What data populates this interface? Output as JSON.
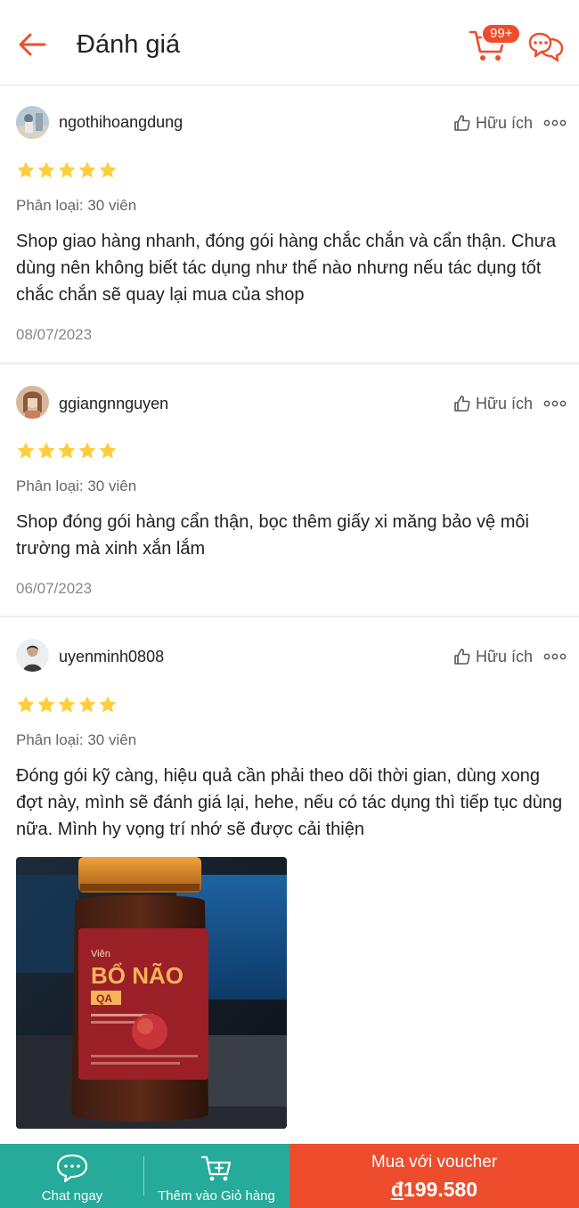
{
  "header": {
    "title": "Đánh giá",
    "cart_badge": "99+"
  },
  "reviews": [
    {
      "username": "ngothihoangdung",
      "helpful_label": "Hữu ích",
      "rating": 5,
      "variant": "Phân loại: 30 viên",
      "comment": "Shop giao hàng nhanh, đóng gói hàng chắc chắn và cẩn thận. Chưa dùng nên không biết tác dụng như thế nào nhưng nếu tác dụng tốt chắc chắn sẽ quay lại mua của shop",
      "date": "08/07/2023"
    },
    {
      "username": "ggiangnnguyen",
      "helpful_label": "Hữu ích",
      "rating": 5,
      "variant": "Phân loại: 30 viên",
      "comment": "Shop đóng gói hàng cẩn thận, bọc thêm giấy xi măng bảo vệ môi trường mà xinh xắn lắm",
      "date": "06/07/2023"
    },
    {
      "username": "uyenminh0808",
      "helpful_label": "Hữu ích",
      "rating": 5,
      "variant": "Phân loại: 30 viên",
      "comment": "Đóng gói kỹ càng, hiệu quả cần phải theo dõi thời gian, dùng xong đợt này, mình sẽ đánh giá lại, hehe, nếu có tác dụng thì tiếp tục dùng nữa. Mình hy vọng trí nhớ sẽ được cải thiện",
      "photo": {
        "label_top": "Viên",
        "label_main": "BỔ NÃO",
        "label_sub": "QA"
      }
    }
  ],
  "bottom_bar": {
    "chat_label": "Chat ngay",
    "add_cart_label": "Thêm vào Giỏ hàng",
    "buy_label": "Mua với voucher",
    "currency": "đ",
    "price": "199.580"
  },
  "colors": {
    "brand": "#ee4d2d",
    "star": "#ffce3d",
    "teal": "#26aa99"
  }
}
